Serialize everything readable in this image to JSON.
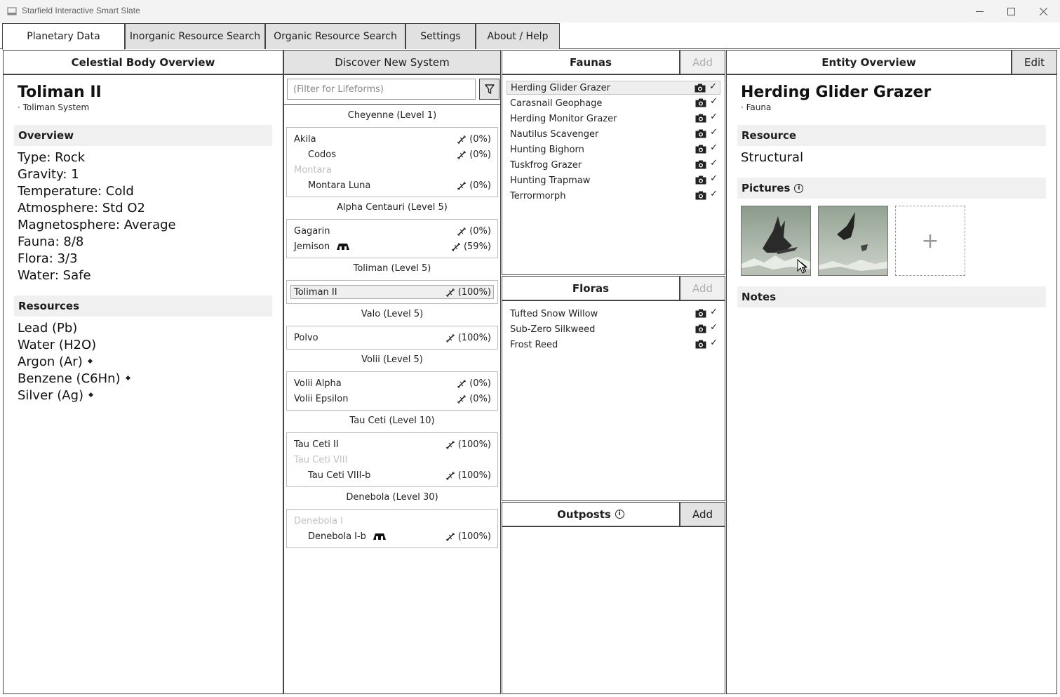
{
  "window": {
    "title": "Starfield Interactive Smart Slate"
  },
  "tabs": [
    {
      "label": "Planetary Data"
    },
    {
      "label": "Inorganic Resource Search"
    },
    {
      "label": "Organic Resource Search"
    },
    {
      "label": "Settings"
    },
    {
      "label": "About / Help"
    }
  ],
  "celestial": {
    "header": "Celestial Body Overview",
    "name": "Toliman II",
    "system": "· Toliman System",
    "overview_label": "Overview",
    "properties": [
      "Type: Rock",
      "Gravity: 1",
      "Temperature: Cold",
      "Atmosphere: Std O2",
      "Magnetosphere: Average",
      "Fauna: 8/8",
      "Flora: 3/3",
      "Water: Safe"
    ],
    "resources_label": "Resources",
    "resources": [
      {
        "name": "Lead (Pb)",
        "marked": false
      },
      {
        "name": "Water (H2O)",
        "marked": false
      },
      {
        "name": "Argon (Ar)",
        "marked": true
      },
      {
        "name": "Benzene (C6Hn)",
        "marked": true
      },
      {
        "name": "Silver (Ag)",
        "marked": true
      }
    ]
  },
  "systems": {
    "header": "Discover New System",
    "filter_placeholder": "(Filter for Lifeforms)",
    "groups": [
      {
        "title": "Cheyenne (Level 1)",
        "bodies": [
          {
            "name": "Akila",
            "pct": "(0%)",
            "dim": false,
            "indent": false,
            "outpost": false
          },
          {
            "name": "Codos",
            "pct": "(0%)",
            "dim": false,
            "indent": true,
            "outpost": false
          },
          {
            "name": "Montara",
            "pct": "",
            "dim": true,
            "indent": false,
            "outpost": false
          },
          {
            "name": "Montara Luna",
            "pct": "(0%)",
            "dim": false,
            "indent": true,
            "outpost": false
          }
        ]
      },
      {
        "title": "Alpha Centauri (Level 5)",
        "bodies": [
          {
            "name": "Gagarin",
            "pct": "(0%)",
            "dim": false,
            "indent": false,
            "outpost": false
          },
          {
            "name": "Jemison",
            "pct": "(59%)",
            "dim": false,
            "indent": false,
            "outpost": true
          }
        ]
      },
      {
        "title": "Toliman (Level 5)",
        "bodies": [
          {
            "name": "Toliman II",
            "pct": "(100%)",
            "dim": false,
            "indent": false,
            "outpost": false,
            "selected": true
          }
        ]
      },
      {
        "title": "Valo (Level 5)",
        "bodies": [
          {
            "name": "Polvo",
            "pct": "(100%)",
            "dim": false,
            "indent": false,
            "outpost": false
          }
        ]
      },
      {
        "title": "Volii (Level 5)",
        "bodies": [
          {
            "name": "Volii Alpha",
            "pct": "(0%)",
            "dim": false,
            "indent": false,
            "outpost": false
          },
          {
            "name": "Volii Epsilon",
            "pct": "(0%)",
            "dim": false,
            "indent": false,
            "outpost": false
          }
        ]
      },
      {
        "title": "Tau Ceti (Level 10)",
        "bodies": [
          {
            "name": "Tau Ceti II",
            "pct": "(100%)",
            "dim": false,
            "indent": false,
            "outpost": false
          },
          {
            "name": "Tau Ceti VIII",
            "pct": "",
            "dim": true,
            "indent": false,
            "outpost": false
          },
          {
            "name": "Tau Ceti VIII-b",
            "pct": "(100%)",
            "dim": false,
            "indent": true,
            "outpost": false
          }
        ]
      },
      {
        "title": "Denebola (Level 30)",
        "bodies": [
          {
            "name": "Denebola I",
            "pct": "",
            "dim": true,
            "indent": false,
            "outpost": false
          },
          {
            "name": "Denebola I-b",
            "pct": "(100%)",
            "dim": false,
            "indent": true,
            "outpost": true
          }
        ]
      }
    ]
  },
  "faunas": {
    "header": "Faunas",
    "add_label": "Add",
    "items": [
      {
        "name": "Herding Glider Grazer",
        "selected": true
      },
      {
        "name": "Carasnail Geophage"
      },
      {
        "name": "Herding Monitor Grazer"
      },
      {
        "name": "Nautilus Scavenger"
      },
      {
        "name": "Hunting Bighorn"
      },
      {
        "name": "Tuskfrog Grazer"
      },
      {
        "name": "Hunting Trapmaw"
      },
      {
        "name": "Terrormorph"
      }
    ]
  },
  "floras": {
    "header": "Floras",
    "add_label": "Add",
    "items": [
      {
        "name": "Tufted Snow Willow"
      },
      {
        "name": "Sub-Zero Silkweed"
      },
      {
        "name": "Frost Reed"
      }
    ]
  },
  "outposts": {
    "header": "Outposts",
    "add_label": "Add"
  },
  "entity": {
    "header": "Entity Overview",
    "edit_label": "Edit",
    "name": "Herding Glider Grazer",
    "kind": "· Fauna",
    "resource_label": "Resource",
    "resource_value": "Structural",
    "pictures_label": "Pictures",
    "notes_label": "Notes",
    "add_picture_glyph": "+"
  },
  "marks": {
    "check": "✓"
  }
}
